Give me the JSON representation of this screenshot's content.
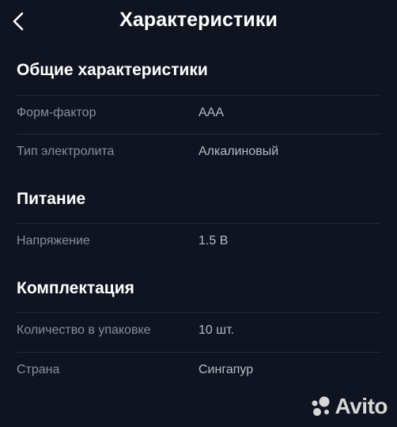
{
  "header": {
    "title": "Характеристики"
  },
  "sections": [
    {
      "title": "Общие характеристики",
      "rows": [
        {
          "label": "Форм-фактор",
          "value": "AAA"
        },
        {
          "label": "Тип электролита",
          "value": "Алкалиновый"
        }
      ]
    },
    {
      "title": "Питание",
      "rows": [
        {
          "label": "Напряжение",
          "value": "1.5 В"
        }
      ]
    },
    {
      "title": "Комплектация",
      "rows": [
        {
          "label": "Количество в упаковке",
          "value": "10 шт."
        },
        {
          "label": "Страна",
          "value": "Сингапур"
        }
      ]
    }
  ],
  "watermark": {
    "text": "Avito",
    "logo_icon": "avito-logo-icon"
  },
  "colors": {
    "background": "#101420",
    "label": "#8a8f9c",
    "value": "#b7bbc4",
    "divider": "#242a38"
  }
}
